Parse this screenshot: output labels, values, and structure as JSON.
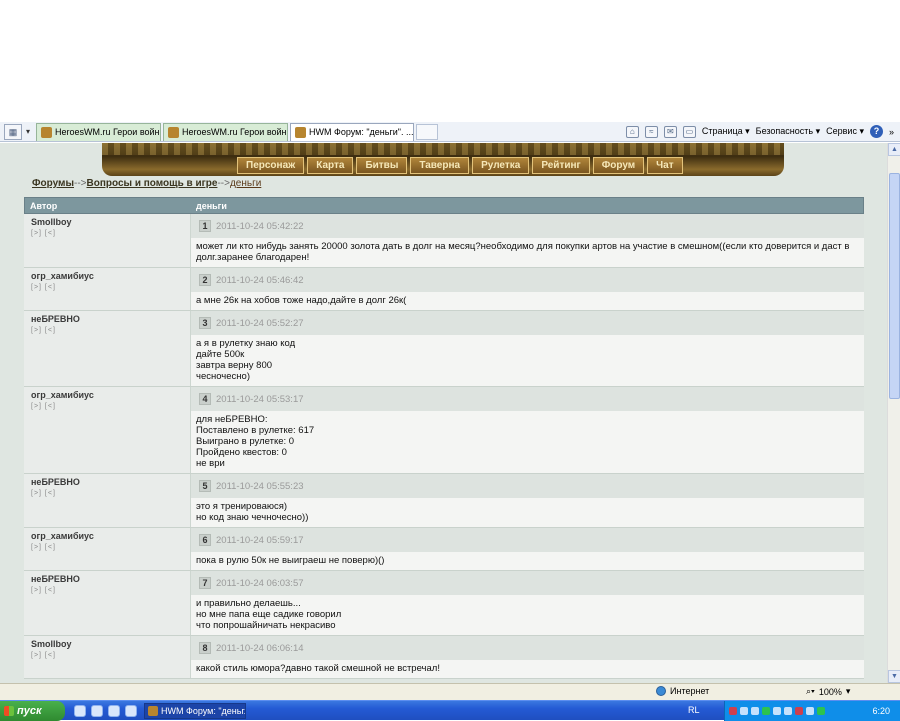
{
  "browser": {
    "tabs": [
      {
        "title": "HeroesWM.ru Герои войны ...",
        "active": false
      },
      {
        "title": "HeroesWM.ru Герои войны ...",
        "active": false
      },
      {
        "title": "HWM Форум: \"деньги\". ...",
        "active": true
      }
    ],
    "toolbar": {
      "page_label": "Страница",
      "safety_label": "Безопасность",
      "tools_label": "Сервис"
    }
  },
  "game_menu": {
    "items": [
      "Персонаж",
      "Карта",
      "Битвы",
      "Таверна",
      "Рулетка",
      "Рейтинг",
      "Форум",
      "Чат"
    ]
  },
  "breadcrumb": {
    "forums": "Форумы",
    "sep1": "-->",
    "section": "Вопросы и помощь в игре",
    "sep2": "-->",
    "topic": "деньги"
  },
  "table": {
    "col_author": "Автор",
    "col_topic": "деньги",
    "author_links": "[>] [<]"
  },
  "posts": [
    {
      "author": "Smollboy",
      "num": "1",
      "date": "2011-10-24 05:42:22",
      "text": "может ли кто нибудь занять 20000 золота дать в долг на месяц?необходимо для покупки артов на участие в смешном((если кто доверится и даст в долг.заранее благодарен!"
    },
    {
      "author": "огр_хамибиус",
      "num": "2",
      "date": "2011-10-24 05:46:42",
      "text": "а мне 26к на хобов тоже надо,дайте в долг 26к("
    },
    {
      "author": "неБРЕВНО",
      "num": "3",
      "date": "2011-10-24 05:52:27",
      "text": "а я в рулетку знаю код\nдайте 500к\nзавтра верну 800\nчесночесно)"
    },
    {
      "author": "огр_хамибиус",
      "num": "4",
      "date": "2011-10-24 05:53:17",
      "text": "для неБРЕВНО:\nПоставлено в рулетке: 617\nВыиграно в рулетке: 0\nПройдено квестов: 0\nне ври"
    },
    {
      "author": "неБРЕВНО",
      "num": "5",
      "date": "2011-10-24 05:55:23",
      "text": "это я тренироваюся)\nно код знаю чечночесно))"
    },
    {
      "author": "огр_хамибиус",
      "num": "6",
      "date": "2011-10-24 05:59:17",
      "text": "пока в рулю 50к не выиграеш не поверю)()"
    },
    {
      "author": "неБРЕВНО",
      "num": "7",
      "date": "2011-10-24 06:03:57",
      "text": "и правильно делаешь...\nно мне папа еще садике говорил\nчто попрошайничать некрасиво"
    },
    {
      "author": "Smollboy",
      "num": "8",
      "date": "2011-10-24 06:06:14",
      "text": "какой стиль юмора?давно такой смешной не встречал!"
    }
  ],
  "status_bar": {
    "zone": "Интернет",
    "zoom": "100%"
  },
  "taskbar": {
    "start": "пуск",
    "task": "HWM Форум: \"деньг...",
    "lang": "RL",
    "clock": "6:20"
  }
}
